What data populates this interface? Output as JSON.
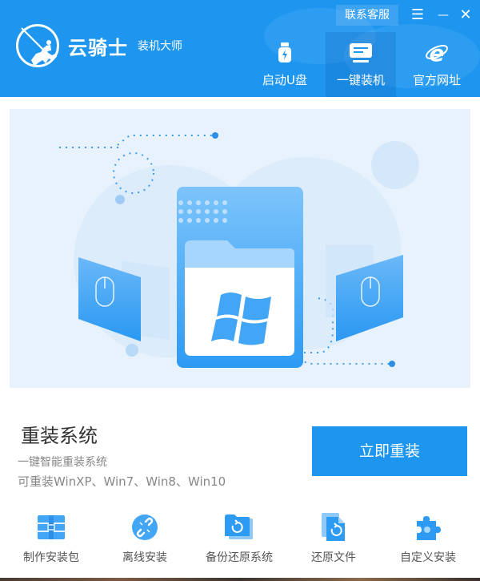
{
  "header": {
    "brand_main": "云骑士",
    "brand_sub": "装机大师",
    "logo_icon": "knight-logo-icon",
    "service_label": "联系客服",
    "window_controls": [
      {
        "name": "menu",
        "glyph": "☰"
      },
      {
        "name": "minimize",
        "glyph": "—"
      },
      {
        "name": "close",
        "glyph": "✕"
      }
    ],
    "nav": [
      {
        "label": "启动U盘",
        "icon": "usb-drive-icon",
        "active": false
      },
      {
        "label": "一键装机",
        "icon": "monitor-icon",
        "active": true
      },
      {
        "label": "官方网址",
        "icon": "ie-browser-icon",
        "active": false
      }
    ]
  },
  "banner": {
    "illustration": "windows-folder-illustration"
  },
  "main": {
    "title": "重装系统",
    "desc1": "一键智能重装系统",
    "desc2": "可重装WinXP、Win7、Win8、Win10",
    "button_label": "立即重装"
  },
  "tools": [
    {
      "label": "制作安装包",
      "icon": "package-icon"
    },
    {
      "label": "离线安装",
      "icon": "offline-link-icon"
    },
    {
      "label": "备份还原系统",
      "icon": "backup-restore-icon"
    },
    {
      "label": "还原文件",
      "icon": "restore-file-icon"
    },
    {
      "label": "自定义安装",
      "icon": "puzzle-icon"
    }
  ],
  "colors": {
    "brand_blue": "#1e96f0",
    "banner_bg": "#e7f2fd",
    "text_dark": "#333333",
    "text_gray": "#888888"
  }
}
